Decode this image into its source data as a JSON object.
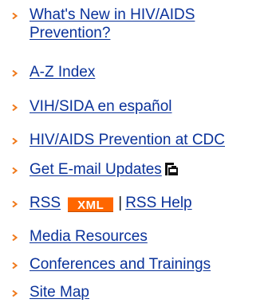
{
  "nav": {
    "items": [
      {
        "label": "What's New in HIV/AIDS",
        "label2": "Prevention?"
      },
      {
        "label": "A-Z Index"
      },
      {
        "label": "VIH/SIDA en español"
      },
      {
        "label": "HIV/AIDS Prevention at CDC"
      },
      {
        "label": "Get E-mail Updates",
        "icon": "email-updates-icon"
      },
      {
        "label": "RSS",
        "badge": "XML",
        "separator": "|",
        "label2": "RSS Help"
      },
      {
        "label": "Media Resources"
      },
      {
        "label": "Conferences and Trainings"
      },
      {
        "label": "Site Map"
      }
    ],
    "arrow_icon": "chevron-right-icon",
    "colors": {
      "link": "#0a329a",
      "arrow": "#f07a1c",
      "xml_badge": "#ff6600"
    }
  }
}
